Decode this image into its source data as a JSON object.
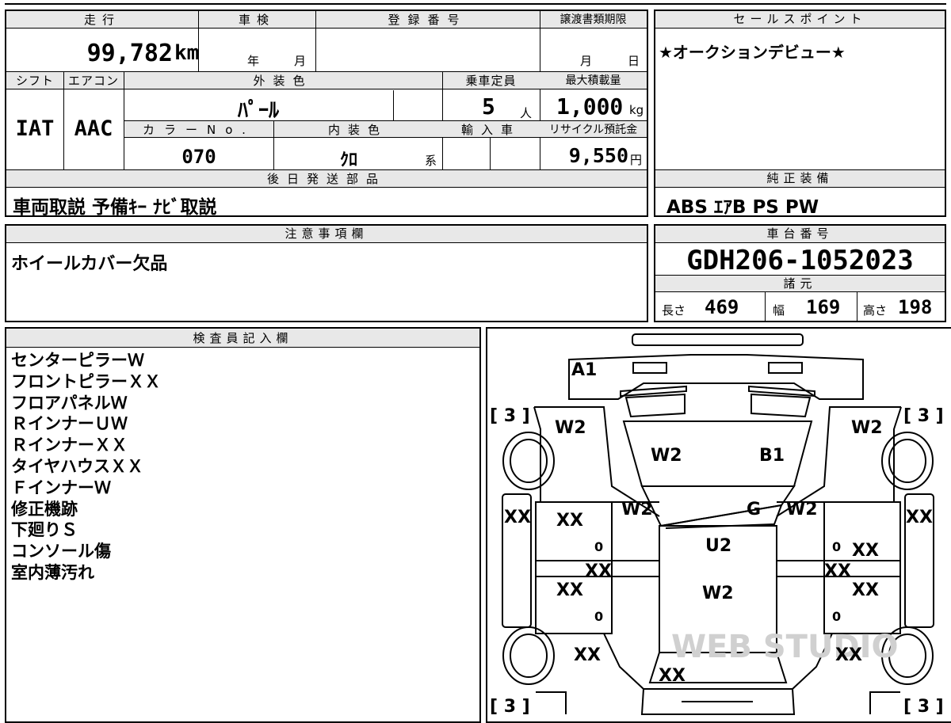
{
  "top": {
    "mileage_label": "走行",
    "mileage_value": "99,782",
    "mileage_unit": "km",
    "inspection_label": "車検",
    "inspection_year": "年",
    "inspection_month": "月",
    "registration_label": "登録番号",
    "transfer_label": "譲渡書類期限",
    "transfer_month": "月",
    "transfer_day": "日"
  },
  "spec": {
    "shift_label": "シフト",
    "shift_value": "IAT",
    "ac_label": "エアコン",
    "ac_value": "AAC",
    "exterior_label": "外装色",
    "exterior_value": "ﾊﾟｰﾙ",
    "capacity_label": "乗車定員",
    "capacity_value": "5",
    "capacity_unit": "人",
    "load_label": "最大積載量",
    "load_value": "1,000",
    "load_unit": "kg",
    "color_no_label": "カラーNo.",
    "color_no_value": "070",
    "interior_label": "内装色",
    "interior_value": "ｸﾛ",
    "interior_unit": "系",
    "import_label": "輸入車",
    "recycle_label": "リサイクル預託金",
    "recycle_value": "9,550",
    "recycle_unit": "円"
  },
  "later_parts": {
    "label": "後日発送部品",
    "value": "車両取説 予備ｷｰ ﾅﾋﾞ取説"
  },
  "sales_point": {
    "label": "セールスポイント",
    "value": "★オークションデビュー★"
  },
  "equipment": {
    "label": "純正装備",
    "value": "ABS ｴｱB PS PW"
  },
  "caution": {
    "label": "注意事項欄",
    "value": "ホイールカバー欠品"
  },
  "chassis": {
    "label": "車台番号",
    "value": "GDH206-1052023",
    "dims_label": "諸元",
    "length_label": "長さ",
    "length_value": "469",
    "width_label": "幅",
    "width_value": "169",
    "height_label": "高さ",
    "height_value": "198"
  },
  "inspector": {
    "label": "検査員記入欄",
    "notes": [
      "センターピラーＷ",
      "フロントピラーＸＸ",
      "フロアパネルＷ",
      "ＲインナーＵＷ",
      "ＲインナーＸＸ",
      "タイヤハウスＸＸ",
      "ＦインナーＷ",
      "修正機跡",
      "下廻りＳ",
      "コンソール傷",
      "室内薄汚れ"
    ]
  },
  "diagram": {
    "tire_tl": "[ 3 ]",
    "tire_tr": "[ 3 ]",
    "tire_bl": "[ 3 ]",
    "tire_br": "[ 3 ]",
    "a1": "A1",
    "w2_front_left": "W2",
    "w2_front_right": "W2",
    "w2_hood_left": "W2",
    "b1": "B1",
    "w2_pillar_left": "W2",
    "w2_pillar_right": "W2",
    "g": "G",
    "u2": "U2",
    "w2_roof": "W2",
    "xx_left_edge": "XX",
    "xx_right_edge": "XX",
    "xx_front_door_left": "XX",
    "xx_front_door_right": "XX",
    "xx_center_left": "XX",
    "xx_center_right": "XX",
    "xx_rear_door_left": "XX",
    "xx_rear_door_right": "XX",
    "xx_rear_left": "XX",
    "xx_rear_right": "XX",
    "xx_rear_center": "XX",
    "zero_1": "0",
    "zero_2": "0",
    "zero_3": "0",
    "zero_4": "0",
    "watermark": "WEB STUDIO"
  }
}
